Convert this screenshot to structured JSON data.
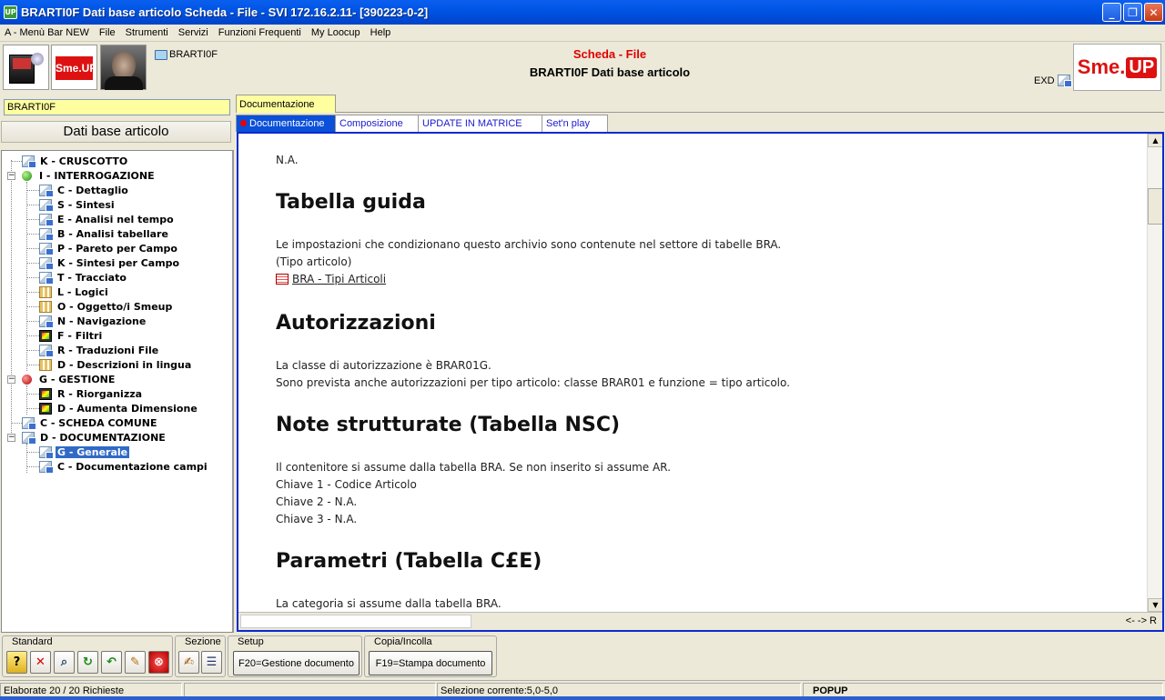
{
  "window": {
    "title": "BRARTI0F Dati base articolo Scheda - File - SVI 172.16.2.11- [390223-0-2]",
    "app_icon": "UP"
  },
  "menu": [
    "A - Menù Bar NEW",
    "File",
    "Strumenti",
    "Servizi",
    "Funzioni Frequenti",
    "My Loocup",
    "Help"
  ],
  "header": {
    "object_link": "BRARTI0F",
    "title1": "Scheda - File",
    "title2": "BRARTI0F Dati base articolo",
    "exd": "EXD",
    "brand_a": "Sme.",
    "brand_b": "UP",
    "logo_small": "Sme.UP"
  },
  "left": {
    "input_value": "BRARTI0F",
    "panel_title": "Dati base articolo",
    "tree": [
      {
        "label": "K - CRUSCOTTO",
        "icon": "doc-icon",
        "level": 1
      },
      {
        "label": "I - INTERROGAZIONE",
        "icon": "green-ball-icon",
        "level": 1,
        "expanded": true
      },
      {
        "label": "C - Dettaglio",
        "icon": "doc-icon",
        "level": 2
      },
      {
        "label": "S - Sintesi",
        "icon": "doc-icon",
        "level": 2
      },
      {
        "label": "E - Analisi nel tempo",
        "icon": "doc-icon",
        "level": 2
      },
      {
        "label": "B - Analisi tabellare",
        "icon": "doc-icon",
        "level": 2
      },
      {
        "label": "P - Pareto per Campo",
        "icon": "doc-icon",
        "level": 2
      },
      {
        "label": "K - Sintesi per Campo",
        "icon": "doc-icon",
        "level": 2
      },
      {
        "label": "T - Tracciato",
        "icon": "doc-icon",
        "level": 2
      },
      {
        "label": "L - Logici",
        "icon": "grid-icon",
        "level": 2
      },
      {
        "label": "O - Oggetto/i Smeup",
        "icon": "grid-icon",
        "level": 2
      },
      {
        "label": "N - Navigazione",
        "icon": "doc-icon",
        "level": 2
      },
      {
        "label": "F - Filtri",
        "icon": "tv-icon",
        "level": 2
      },
      {
        "label": "R - Traduzioni File",
        "icon": "doc-icon",
        "level": 2
      },
      {
        "label": "D - Descrizioni in lingua",
        "icon": "grid-icon",
        "level": 2
      },
      {
        "label": "G - GESTIONE",
        "icon": "red-ball-icon",
        "level": 1,
        "expanded": true
      },
      {
        "label": "R - Riorganizza",
        "icon": "tv-icon",
        "level": 2
      },
      {
        "label": "D - Aumenta Dimensione",
        "icon": "tv-icon",
        "level": 2
      },
      {
        "label": "C - SCHEDA COMUNE",
        "icon": "doc-icon",
        "level": 1
      },
      {
        "label": "D - DOCUMENTAZIONE",
        "icon": "doc-icon",
        "level": 1,
        "expanded": true
      },
      {
        "label": "G - Generale",
        "icon": "doc-icon",
        "level": 2,
        "selected": true
      },
      {
        "label": "C - Documentazione campi",
        "icon": "doc-icon",
        "level": 2
      }
    ]
  },
  "outer_tab": "Documentazione",
  "tabs": [
    {
      "label": "Documentazione",
      "active": true
    },
    {
      "label": "Composizione"
    },
    {
      "label": "UPDATE IN MATRICE"
    },
    {
      "label": "Set'n play"
    }
  ],
  "document": {
    "na_top": "N.A.",
    "h1": "Tabella guida",
    "p1a": "Le impostazioni che condizionano questo archivio sono contenute nel settore di tabelle BRA.",
    "p1b": "(Tipo articolo)",
    "link1": "BRA - Tipi Articoli",
    "h2": "Autorizzazioni",
    "p2a": "La classe di autorizzazione è BRAR01G.",
    "p2b": "Sono prevista anche autorizzazioni per tipo articolo: classe BRAR01 e funzione = tipo articolo.",
    "h3": "Note strutturate (Tabella NSC)",
    "p3a": "Il contenitore si assume dalla tabella BRA. Se non inserito si assume AR.",
    "p3b": "Chiave 1 - Codice Articolo",
    "p3c": "Chiave 2 - N.A.",
    "p3d": "Chiave 3 - N.A.",
    "h4": "Parametri (Tabella C£E)",
    "p4a": "La categoria si assume dalla tabella BRA."
  },
  "nav_text": "<- -> R",
  "toolbar": {
    "standard_label": "Standard",
    "sezione_label": "Sezione",
    "setup_label": "Setup",
    "copia_label": "Copia/Incolla",
    "f20": "F20=Gestione documento",
    "f19": "F19=Stampa documento"
  },
  "status": {
    "left": "Elaborate 20 / 20 Richieste",
    "selection": "Selezione corrente:5,0-5,0",
    "popup": "POPUP"
  }
}
